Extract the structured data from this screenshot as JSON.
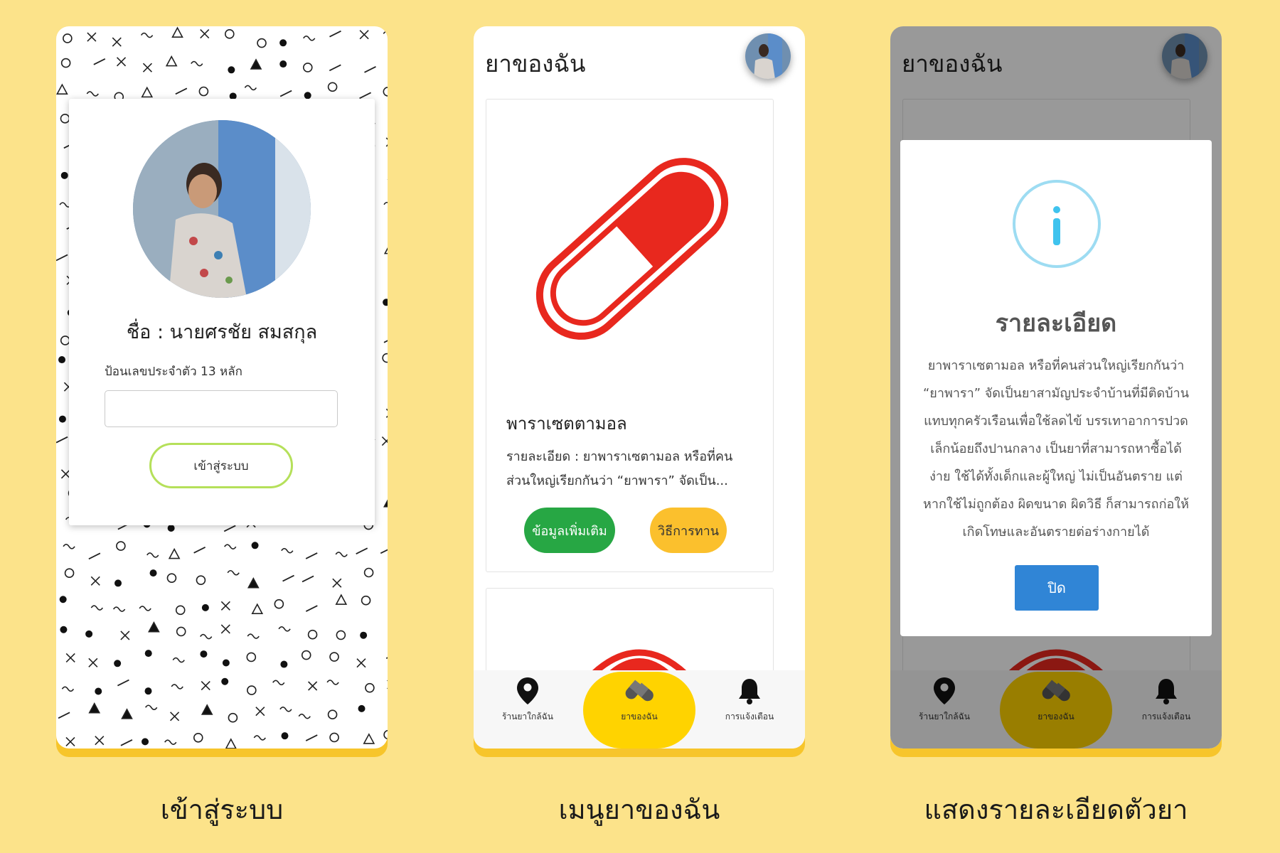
{
  "screens": {
    "login": {
      "caption": "เข้าสู่ระบบ",
      "name_text": "ชื่อ : นายศรชัย สมสกุล",
      "id_label": "ป้อนเลขประจำตัว 13 หลัก",
      "id_value": "",
      "login_button": "เข้าสู่ระบบ"
    },
    "my_medicine": {
      "caption": "เมนูยาของฉัน",
      "title": "ยาของฉัน",
      "medicine": {
        "name": "พาราเซตตามอล",
        "description": "รายละเอียด : ยาพาราเซตามอล หรือที่คนส่วนใหญ่เรียกกันว่า “ยาพารา” จัดเป็น...",
        "more_button": "ข้อมูลเพิ่มเติม",
        "howto_button": "วิธีการทาน"
      }
    },
    "detail": {
      "caption": "แสดงรายละเอียดตัวยา",
      "title": "ยาของฉัน",
      "modal_title": "รายละเอียด",
      "modal_body": "ยาพาราเซตามอล หรือที่คนส่วนใหญ่เรียกกันว่า “ยาพารา” จัดเป็นยาสามัญประจำบ้านที่มีติดบ้านแทบทุกครัวเรือนเพื่อใช้ลดไข้ บรรเทาอาการปวดเล็กน้อยถึงปานกลาง เป็นยาที่สามารถหาซื้อได้ง่าย ใช้ได้ทั้งเด็กและผู้ใหญ่ ไม่เป็นอันตราย แต่หากใช้ไม่ถูกต้อง ผิดขนาด ผิดวิธี ก็สามารถก่อให้เกิดโทษและอันตรายต่อร่างกายได้",
      "close_button": "ปิด"
    }
  },
  "nav": {
    "items": [
      {
        "label": "ร้านยาใกล้ฉัน",
        "icon": "map-pin-icon"
      },
      {
        "label": "ยาของฉัน",
        "icon": "pills-icon"
      },
      {
        "label": "การแจ้งเตือน",
        "icon": "bell-icon"
      }
    ]
  },
  "colors": {
    "background": "#fce38a",
    "accent_yellow": "#ffd300",
    "more_green": "#27a744",
    "howto_yellow": "#fbc02d",
    "close_blue": "#3085d6",
    "pill_red": "#e8281e",
    "info_blue": "#9ddcf2",
    "login_border": "#b5e05a"
  }
}
